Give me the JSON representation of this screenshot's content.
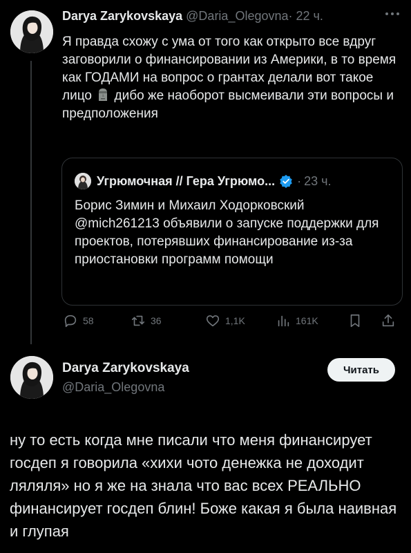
{
  "post1": {
    "author_name": "Darya Zarykovskaya",
    "handle": "@Daria_Olegovna",
    "separator": "·",
    "time": "22 ч.",
    "text_before_emoji": "Я правда схожу с ума от того как открыто все вдруг заговорили о финансировании из Америки, в то время как ГОДАМИ на вопрос о грантах делали вот такое лицо",
    "emoji": "moai-emoji-icon",
    "text_after_emoji": "дибо же наоборот высмеивали эти вопросы и предположения"
  },
  "quote": {
    "author_name": "Угрюмочная // Гера Угрюмо...",
    "separator": "·",
    "time": "23 ч.",
    "text": "Борис Зимин и Михаил Ходорковский @mich261213 объявили о запуске поддержки для проектов, потерявших финансирование из-за приостановки программ помощи"
  },
  "actions": {
    "replies": "58",
    "reposts": "36",
    "likes": "1,1K",
    "views": "161K"
  },
  "post2": {
    "author_name": "Darya Zarykovskaya",
    "handle": "@Daria_Olegovna",
    "read_button": "Читать",
    "text": "ну то есть когда мне писали что меня финансирует госдеп я говорила «хихи чото денежка не доходит ляляля» но я же на знала что вас всех РЕАЛЬНО финансирует госдеп блин! Боже какая я была наивная и глупая"
  },
  "colors": {
    "background": "#000000",
    "text": "#e7e9ea",
    "muted": "#71767b",
    "border": "#2f3336",
    "verified": "#1d9bf0"
  }
}
